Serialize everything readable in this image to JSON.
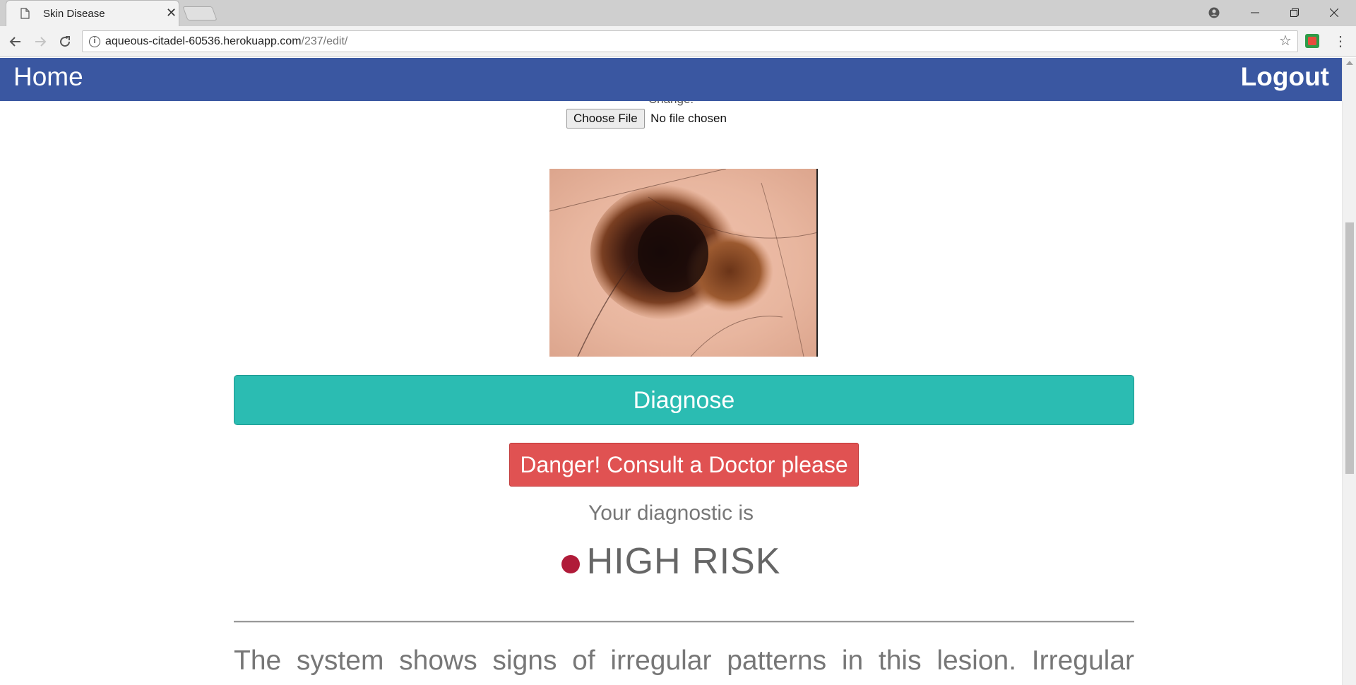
{
  "browser": {
    "tab_title": "Skin Disease",
    "tab_close": "✕",
    "url_host": "aqueous-citadel-60536.herokuapp.com",
    "url_path": "/237/edit/",
    "icons": {
      "back": "arrow-left-icon",
      "forward": "arrow-right-icon",
      "reload": "reload-icon",
      "info": "info-icon",
      "star": "star-icon",
      "menu": "kebab-menu-icon"
    }
  },
  "nav": {
    "home": "Home",
    "logout": "Logout"
  },
  "upload": {
    "change_label": "Change:",
    "choose_file": "Choose File",
    "file_status": "No file chosen"
  },
  "actions": {
    "diagnose": "Diagnose",
    "danger_alert": "Danger! Consult a Doctor please"
  },
  "result": {
    "label": "Your diagnostic is",
    "risk_level": "HIGH RISK",
    "risk_color": "#b01b39",
    "description": "The system shows signs of irregular patterns in this lesion. Irregular"
  },
  "colors": {
    "navbar": "#3a57a1",
    "diagnose_button": "#2bbcb2",
    "danger_button": "#e05252"
  }
}
